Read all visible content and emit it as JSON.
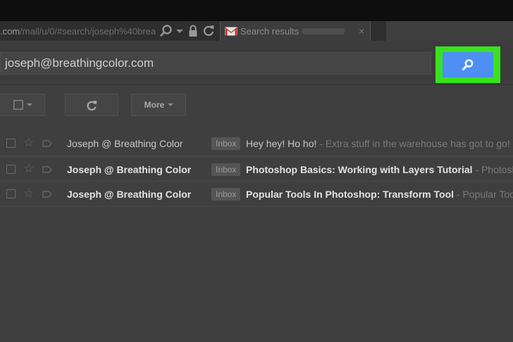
{
  "browser": {
    "url_prefix": ".com",
    "url_rest": "/mail/u/0/#search/joseph%40brea",
    "tab_title": "Search results -",
    "tab_close": "×"
  },
  "search": {
    "query": "joseph@breathingcolor.com",
    "highlight_color": "#39e21e",
    "button_color": "#4d8ff4"
  },
  "toolbar": {
    "more_label": "More"
  },
  "messages": [
    {
      "sender": "Joseph @ Breathing Color",
      "label": "Inbox",
      "subject": "Hey hey! Ho ho!",
      "snippet": " - Extra stuff in the warehouse has got to go! S",
      "unread": false
    },
    {
      "sender": "Joseph @ Breathing Color",
      "label": "Inbox",
      "subject": "Photoshop Basics: Working with Layers Tutorial",
      "snippet": " - Photosh",
      "unread": true
    },
    {
      "sender": "Joseph @ Breathing Color",
      "label": "Inbox",
      "subject": "Popular Tools In Photoshop: Transform Tool",
      "snippet": " - Popular Too",
      "unread": true
    }
  ],
  "icons": {
    "address_bar": [
      "search-icon",
      "dropdown-arrow-icon",
      "lock-icon",
      "reload-icon"
    ],
    "tab": "gmail-icon",
    "search_button": "search-icon",
    "toolbar": [
      "checkbox-icon",
      "chevron-down-icon",
      "refresh-icon",
      "chevron-down-icon"
    ]
  }
}
